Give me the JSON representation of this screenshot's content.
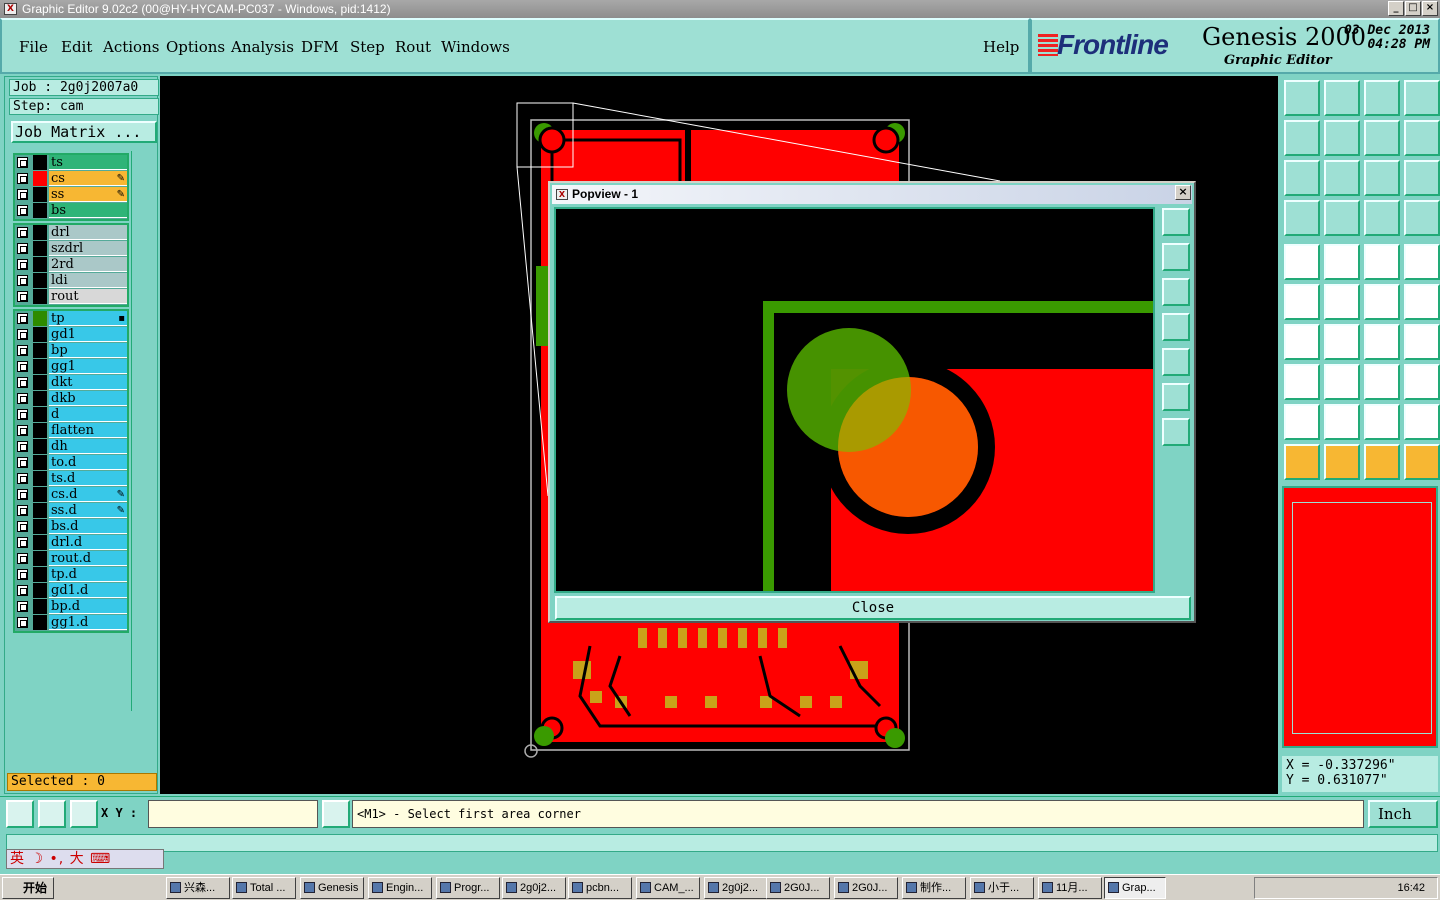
{
  "window": {
    "title": "Graphic Editor 9.02c2 (00@HY-HYCAM-PC037 - Windows, pid:1412)",
    "icon": "app-x-icon"
  },
  "menu": {
    "items": [
      "File",
      "Edit",
      "Actions",
      "Options",
      "Analysis",
      "DFM",
      "Step",
      "Rout",
      "Windows"
    ],
    "help": "Help"
  },
  "brand": {
    "logo": "Frontline",
    "product": "Genesis 2000",
    "subtitle": "Graphic Editor",
    "date": "03 Dec 2013",
    "time": "04:28 PM"
  },
  "job": {
    "job_label": "Job : 2g0j2007a0",
    "step_label": "Step: cam",
    "matrix_button": "Job Matrix ..."
  },
  "layer_groups": [
    [
      {
        "name": "ts",
        "color": "#2fb478",
        "swatch": "#000000",
        "mark": ""
      },
      {
        "name": "cs",
        "color": "#f7b733",
        "swatch": "#ff0000",
        "mark": "✎"
      },
      {
        "name": "ss",
        "color": "#f7b733",
        "swatch": "#000000",
        "mark": "✎"
      },
      {
        "name": "bs",
        "color": "#2fb478",
        "swatch": "#000000",
        "mark": ""
      }
    ],
    [
      {
        "name": "drl",
        "color": "#aac8c8",
        "swatch": "#000000",
        "mark": ""
      },
      {
        "name": "szdrl",
        "color": "#aac8c8",
        "swatch": "#000000",
        "mark": ""
      },
      {
        "name": "2rd",
        "color": "#aac8c8",
        "swatch": "#000000",
        "mark": ""
      },
      {
        "name": "ldi",
        "color": "#aac8c8",
        "swatch": "#000000",
        "mark": ""
      },
      {
        "name": "rout",
        "color": "#d8d8d8",
        "swatch": "#000000",
        "mark": ""
      }
    ],
    [
      {
        "name": "tp",
        "color": "#38c8e8",
        "swatch": "#2e8b00",
        "mark": "▪"
      },
      {
        "name": "gd1",
        "color": "#38c8e8",
        "swatch": "#000000",
        "mark": ""
      },
      {
        "name": "bp",
        "color": "#38c8e8",
        "swatch": "#000000",
        "mark": ""
      },
      {
        "name": "gg1",
        "color": "#38c8e8",
        "swatch": "#000000",
        "mark": ""
      },
      {
        "name": "dkt",
        "color": "#38c8e8",
        "swatch": "#000000",
        "mark": ""
      },
      {
        "name": "dkb",
        "color": "#38c8e8",
        "swatch": "#000000",
        "mark": ""
      },
      {
        "name": "d",
        "color": "#38c8e8",
        "swatch": "#000000",
        "mark": ""
      },
      {
        "name": "flatten",
        "color": "#38c8e8",
        "swatch": "#000000",
        "mark": ""
      },
      {
        "name": "dh",
        "color": "#38c8e8",
        "swatch": "#000000",
        "mark": ""
      },
      {
        "name": "to.d",
        "color": "#38c8e8",
        "swatch": "#000000",
        "mark": ""
      },
      {
        "name": "ts.d",
        "color": "#38c8e8",
        "swatch": "#000000",
        "mark": ""
      },
      {
        "name": "cs.d",
        "color": "#38c8e8",
        "swatch": "#000000",
        "mark": "✎"
      },
      {
        "name": "ss.d",
        "color": "#38c8e8",
        "swatch": "#000000",
        "mark": "✎"
      },
      {
        "name": "bs.d",
        "color": "#38c8e8",
        "swatch": "#000000",
        "mark": ""
      },
      {
        "name": "drl.d",
        "color": "#38c8e8",
        "swatch": "#000000",
        "mark": ""
      },
      {
        "name": "rout.d",
        "color": "#38c8e8",
        "swatch": "#000000",
        "mark": ""
      },
      {
        "name": "tp.d",
        "color": "#38c8e8",
        "swatch": "#000000",
        "mark": ""
      },
      {
        "name": "gd1.d",
        "color": "#38c8e8",
        "swatch": "#000000",
        "mark": ""
      },
      {
        "name": "bp.d",
        "color": "#38c8e8",
        "swatch": "#000000",
        "mark": ""
      },
      {
        "name": "gg1.d",
        "color": "#38c8e8",
        "swatch": "#000000",
        "mark": ""
      }
    ]
  ],
  "selected": "Selected : 0",
  "popview": {
    "title": "Popview - 1",
    "close": "Close"
  },
  "coords": {
    "x": "X = -0.337296\"",
    "y": "Y = 0.631077\""
  },
  "command": {
    "xy_label": "X Y :",
    "xy_value": "",
    "prompt": "<M1> - Select first area corner",
    "unit": "Inch"
  },
  "ime": "英 ☽ •, 大 ⌨",
  "taskbar": {
    "start": "开始",
    "items": [
      "兴森...",
      "Total ...",
      "Genesis",
      "Engin...",
      "Progr...",
      "2g0j2...",
      "pcbn...",
      "CAM_...",
      "2g0j2...",
      "2G0J...",
      "2G0J...",
      "制作...",
      "小于...",
      "11月...",
      "Grap..."
    ],
    "clock": "16:42"
  }
}
